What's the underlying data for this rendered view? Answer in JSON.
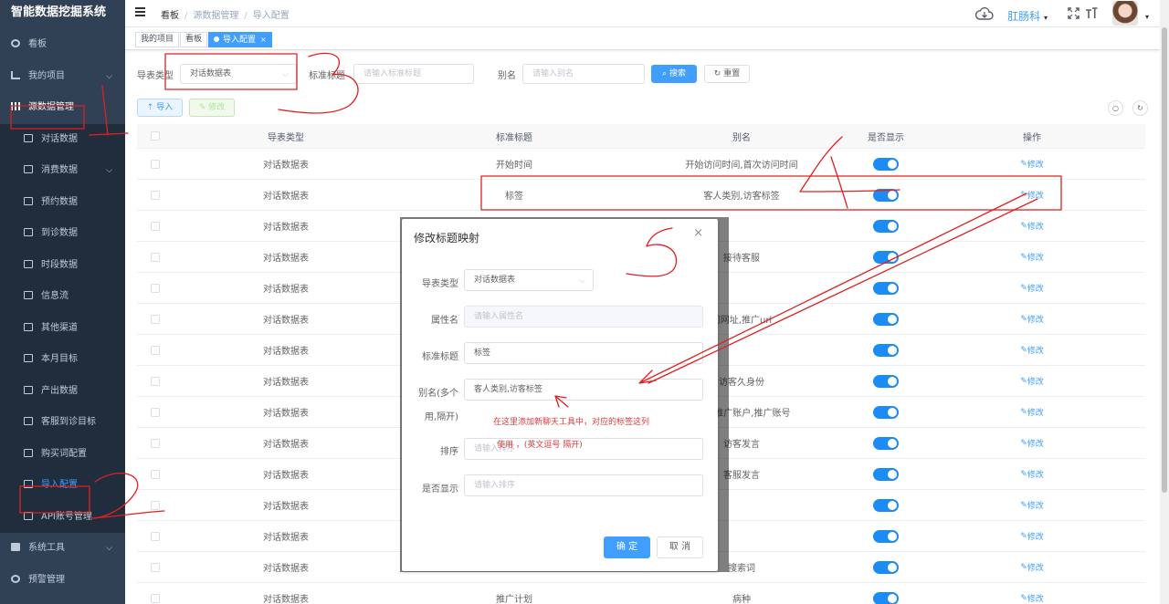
{
  "app": {
    "title": "智能数据挖掘系统"
  },
  "sidebar": {
    "items": [
      {
        "label": "看板",
        "level": "top",
        "icon": "dashboard-icon"
      },
      {
        "label": "我的项目",
        "level": "top",
        "icon": "tree-icon",
        "arrow": true
      },
      {
        "label": "源数据管理",
        "level": "top",
        "icon": "chart-icon",
        "arrow": false
      },
      {
        "label": "对话数据",
        "level": "sub",
        "icon": "doc-icon"
      },
      {
        "label": "消费数据",
        "level": "sub",
        "icon": "doc-icon",
        "arrow": true
      },
      {
        "label": "预约数据",
        "level": "sub",
        "icon": "doc-icon"
      },
      {
        "label": "到诊数据",
        "level": "sub",
        "icon": "doc-icon"
      },
      {
        "label": "时段数据",
        "level": "sub",
        "icon": "doc-icon"
      },
      {
        "label": "信息流",
        "level": "sub",
        "icon": "doc-icon"
      },
      {
        "label": "其他渠道",
        "level": "sub",
        "icon": "doc-icon"
      },
      {
        "label": "本月目标",
        "level": "sub",
        "icon": "doc-icon"
      },
      {
        "label": "产出数据",
        "level": "sub",
        "icon": "doc-icon"
      },
      {
        "label": "客服到诊目标",
        "level": "sub",
        "icon": "doc-icon"
      },
      {
        "label": "购买词配置",
        "level": "sub",
        "icon": "doc-icon"
      },
      {
        "label": "导入配置",
        "level": "sub",
        "icon": "doc-icon",
        "active": true
      },
      {
        "label": "API账号管理",
        "level": "sub",
        "icon": "doc-icon"
      },
      {
        "label": "系统工具",
        "level": "top",
        "icon": "tool-icon",
        "arrow": true
      },
      {
        "label": "预警管理",
        "level": "top",
        "icon": "gear-icon"
      }
    ]
  },
  "header": {
    "breadcrumb": [
      "看板",
      "源数据管理",
      "导入配置"
    ],
    "user_name": "肛肠科",
    "icons": [
      "cloud-icon",
      "fullscreen-icon",
      "font-size-icon"
    ]
  },
  "tags": [
    {
      "label": "我的项目"
    },
    {
      "label": "看板"
    },
    {
      "label": "导入配置",
      "active": true
    }
  ],
  "filters": {
    "type_label": "导表类型",
    "type_value": "对话数据表",
    "title_label": "标准标题",
    "title_placeholder": "请输入标准标题",
    "alias_label": "别名",
    "alias_placeholder": "请输入别名",
    "search_button": "搜索",
    "reset_button": "重置"
  },
  "toolbar": {
    "import_button": "导入",
    "edit_button": "修改"
  },
  "table": {
    "columns": [
      "导表类型",
      "标准标题",
      "别名",
      "是否显示",
      "操作"
    ],
    "op_label": "修改",
    "rows": [
      {
        "type": "对话数据表",
        "title": "开始时间",
        "alias": "开始访问时间,首次访问时间"
      },
      {
        "type": "对话数据表",
        "title": "标签",
        "alias": "客人类别,访客标签"
      },
      {
        "type": "对话数据表",
        "title": "",
        "alias": ""
      },
      {
        "type": "对话数据表",
        "title": "",
        "alias": "接待客服"
      },
      {
        "type": "对话数据表",
        "title": "",
        "alias": ""
      },
      {
        "type": "对话数据表",
        "title": "",
        "alias": "问网址,推广url"
      },
      {
        "type": "对话数据表",
        "title": "",
        "alias": ""
      },
      {
        "type": "对话数据表",
        "title": "",
        "alias": "访客久身份"
      },
      {
        "type": "对话数据表",
        "title": "",
        "alias": "户ID,推广账户,推广账号"
      },
      {
        "type": "对话数据表",
        "title": "",
        "alias": "访客发言"
      },
      {
        "type": "对话数据表",
        "title": "",
        "alias": "客服发言"
      },
      {
        "type": "对话数据表",
        "title": "",
        "alias": ""
      },
      {
        "type": "对话数据表",
        "title": "",
        "alias": ""
      },
      {
        "type": "对话数据表",
        "title": "",
        "alias": "搜索词"
      },
      {
        "type": "对话数据表",
        "title": "推广计划",
        "alias": "病种"
      }
    ]
  },
  "dialog": {
    "title": "修改标题映射",
    "fields": {
      "type_label": "导表类型",
      "type_value": "对话数据表",
      "attr_label": "属性名",
      "attr_placeholder": "请输入属性名",
      "title_label": "标准标题",
      "title_value": "标签",
      "alias_label_1": "别名(多个",
      "alias_label_2": "用,隔开)",
      "alias_value": "客人类别,访客标签",
      "sort_label": "排序",
      "sort_placeholder": "请输入排序",
      "show_label": "是否显示",
      "show_placeholder": "请输入排序"
    },
    "note_line1": "在这里添加新聊天工具中，对应的标签这列",
    "note_line2": "使用 ，(英文逗号 隔开)",
    "confirm_button": "确 定",
    "cancel_button": "取 消"
  },
  "colors": {
    "sidebar_bg": "#304156",
    "primary": "#409eff",
    "annotation": "#e02020"
  }
}
